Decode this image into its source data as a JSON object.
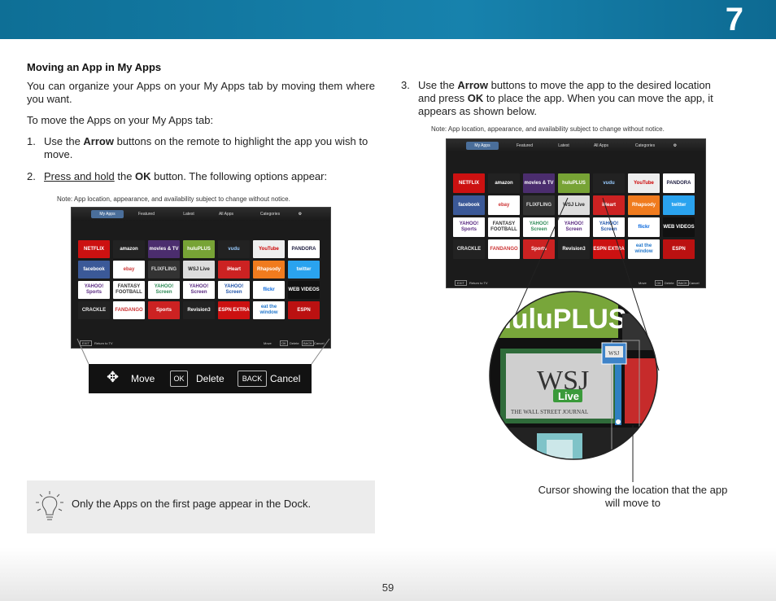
{
  "header": {
    "chapter": "7"
  },
  "section_title": "Moving an App in My Apps",
  "intro": "You can organize your Apps on your My Apps tab by moving them where you want.",
  "lead": "To move the Apps on your My Apps tab:",
  "step1": {
    "num": "1.",
    "pre": "Use the ",
    "bold": "Arrow",
    "post": " buttons on the remote to highlight the app you wish to move."
  },
  "step2": {
    "num": "2.",
    "u": "Press and hold",
    "pre": " the ",
    "bold": "OK",
    "post": " button. The following options appear:"
  },
  "step3": {
    "num": "3.",
    "pre": "Use the ",
    "bold1": "Arrow",
    "mid": " buttons to move the app to the desired location and press ",
    "bold2": "OK",
    "post": " to place the app. When you can move the app, it appears as shown below."
  },
  "note": "Note: App location, appearance, and availability subject to change without notice.",
  "tv": {
    "tabs": [
      "My Apps",
      "Featured",
      "Latest",
      "All Apps",
      "Categories"
    ],
    "bottom": {
      "exit": "EXIT",
      "return": "Return to TV",
      "move": "Move",
      "ok": "OK",
      "delete": "Delete",
      "back": "BACK",
      "cancel": "Cancel"
    },
    "apps": [
      [
        "NETFLIX",
        "amazon",
        "movies & TV",
        "huluPLUS",
        "vudu",
        "YouTube",
        "PANDORA"
      ],
      [
        "facebook",
        "ebay",
        "FLIXFLING",
        "WSJ Live",
        "iHeart",
        "Rhapsody",
        "twitter"
      ],
      [
        "YAHOO! Sports",
        "FANTASY FOOTBALL",
        "YAHOO! Screen",
        "YAHOO! Screen",
        "YAHOO! Screen",
        "flickr",
        "WEB VIDEOS"
      ],
      [
        "CRACKLE",
        "FANDANGO",
        "Sports",
        "Revision3",
        "ESPN EXTRA",
        "eat the window",
        "ESPN"
      ]
    ]
  },
  "zoom_bar": {
    "move": "Move",
    "ok": "OK",
    "delete": "Delete",
    "back": "BACK",
    "cancel": "Cancel"
  },
  "zoom": {
    "hulu": "huluPLUS",
    "wsj": "WSJ",
    "live": "Live",
    "wsj_sub": "THE WALL STREET JOURNAL",
    "mini_wsj": "WSJ"
  },
  "tip": "Only the Apps on the first page appear in the Dock.",
  "caption": "Cursor showing the location that the app will move to",
  "page_number": "59",
  "colors": {
    "header": "#1782ad",
    "tip_bg": "#ececec",
    "tab_selected": "#4a6e9a",
    "cursor": "#2e7fc2"
  }
}
